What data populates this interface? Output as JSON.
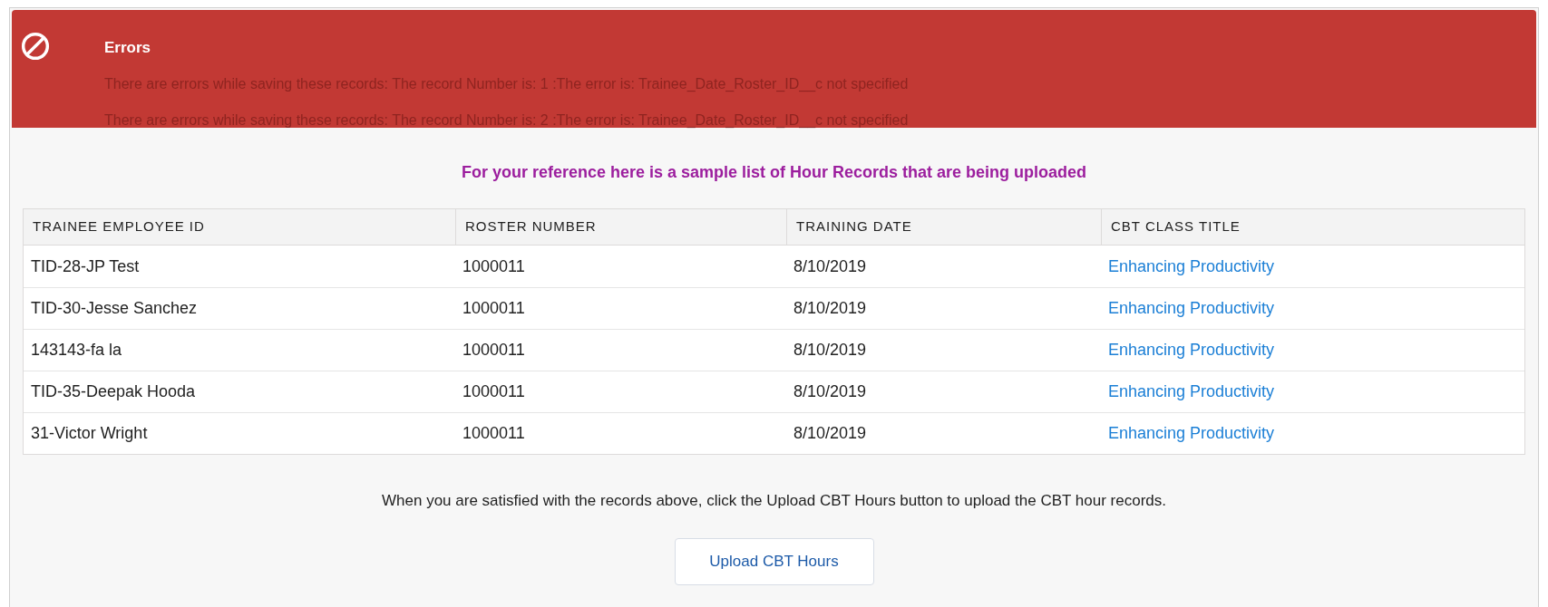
{
  "error_banner": {
    "title": "Errors",
    "messages": [
      "There are errors while saving these records: The record Number is: 1 :The error is: Trainee_Date_Roster_ID__c not specified",
      "There are errors while saving these records: The record Number is: 2 :The error is: Trainee_Date_Roster_ID__c not specified"
    ]
  },
  "heading": "For your reference here is a sample list of Hour Records that are being uploaded",
  "table": {
    "columns": [
      "TRAINEE EMPLOYEE ID",
      "ROSTER NUMBER",
      "TRAINING DATE",
      "CBT CLASS TITLE"
    ],
    "rows": [
      [
        "TID-28-JP Test",
        "1000011",
        "8/10/2019",
        "Enhancing Productivity"
      ],
      [
        "TID-30-Jesse Sanchez",
        "1000011",
        "8/10/2019",
        "Enhancing Productivity"
      ],
      [
        "143143-fa la",
        "1000011",
        "8/10/2019",
        "Enhancing Productivity"
      ],
      [
        "TID-35-Deepak Hooda",
        "1000011",
        "8/10/2019",
        "Enhancing Productivity"
      ],
      [
        "31-Victor Wright",
        "1000011",
        "8/10/2019",
        "Enhancing Productivity"
      ]
    ]
  },
  "instructions": "When you are satisfied with the records above, click the Upload CBT Hours button to upload the CBT hour records.",
  "button": "Upload CBT Hours"
}
